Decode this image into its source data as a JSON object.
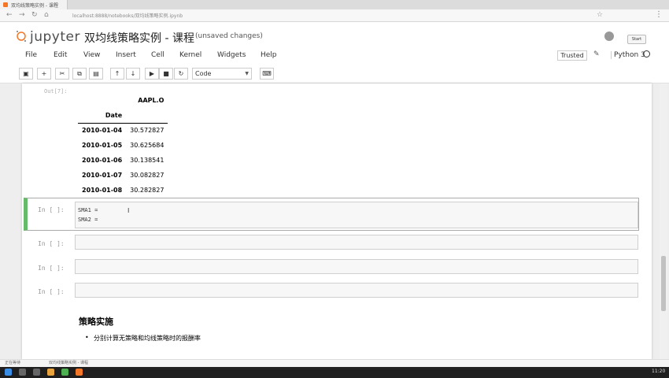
{
  "browser": {
    "tab_title": "双均线策略实例 - 课程",
    "url": "localhost:8888/notebooks/双均线策略实例.ipynb"
  },
  "header": {
    "logo_text": "jupyter",
    "notebook_title": "双均线策略实例 - 课程",
    "save_status": "(unsaved changes)",
    "logout_label": "Start"
  },
  "menu": [
    "File",
    "Edit",
    "View",
    "Insert",
    "Cell",
    "Kernel",
    "Widgets",
    "Help"
  ],
  "kernel": {
    "trusted_label": "Trusted",
    "name": "Python 3"
  },
  "toolbar": {
    "cell_type": "Code"
  },
  "output": {
    "prompt": "Out[7]:",
    "column": "AAPL.O",
    "index_name": "Date",
    "rows": [
      {
        "date": "2010-01-04",
        "value": "30.572827"
      },
      {
        "date": "2010-01-05",
        "value": "30.625684"
      },
      {
        "date": "2010-01-06",
        "value": "30.138541"
      },
      {
        "date": "2010-01-07",
        "value": "30.082827"
      },
      {
        "date": "2010-01-08",
        "value": "30.282827"
      }
    ]
  },
  "cells": [
    {
      "prompt": "In [ ]:",
      "lines": [
        "SMA1 =",
        "SMA2 ="
      ]
    },
    {
      "prompt": "In [ ]:",
      "lines": []
    },
    {
      "prompt": "In [ ]:",
      "lines": []
    },
    {
      "prompt": "In [ ]:",
      "lines": []
    }
  ],
  "markdown": {
    "heading": "策略实施",
    "bullet": "分别计算无策略和均线策略时的报酬率"
  },
  "status": {
    "left": "正在等待",
    "message": "双均线策略实例 - 课程"
  },
  "clock": "11:20"
}
